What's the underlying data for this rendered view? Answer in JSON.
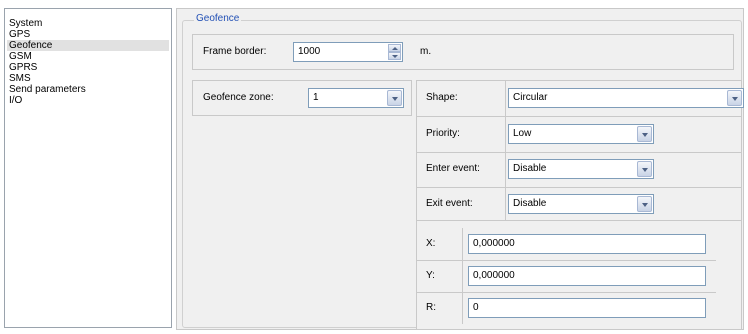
{
  "nav": {
    "items": [
      {
        "label": "System",
        "selected": false
      },
      {
        "label": "GPS",
        "selected": false
      },
      {
        "label": "Geofence",
        "selected": true
      },
      {
        "label": "GSM",
        "selected": false
      },
      {
        "label": "GPRS",
        "selected": false
      },
      {
        "label": "SMS",
        "selected": false
      },
      {
        "label": "Send parameters",
        "selected": false
      },
      {
        "label": "I/O",
        "selected": false
      }
    ]
  },
  "geofence": {
    "group_title": "Geofence",
    "frame_border": {
      "label": "Frame border:",
      "value": "1000",
      "unit": "m."
    },
    "zone": {
      "label": "Geofence zone:",
      "value": "1"
    },
    "shape": {
      "label": "Shape:",
      "value": "Circular"
    },
    "priority": {
      "label": "Priority:",
      "value": "Low"
    },
    "enter_event": {
      "label": "Enter event:",
      "value": "Disable"
    },
    "exit_event": {
      "label": "Exit event:",
      "value": "Disable"
    },
    "x": {
      "label": "X:",
      "value": "0,000000"
    },
    "y": {
      "label": "Y:",
      "value": "0,000000"
    },
    "r": {
      "label": "R:",
      "value": "0"
    }
  },
  "colors": {
    "title_accent": "#2250b5",
    "panel_bg": "#f0f0f0",
    "selection_bg": "#e1e1e1"
  },
  "icons": {
    "combo_arrow": "chevron-down-icon",
    "spin_up": "arrow-up-icon",
    "spin_down": "arrow-down-icon"
  }
}
